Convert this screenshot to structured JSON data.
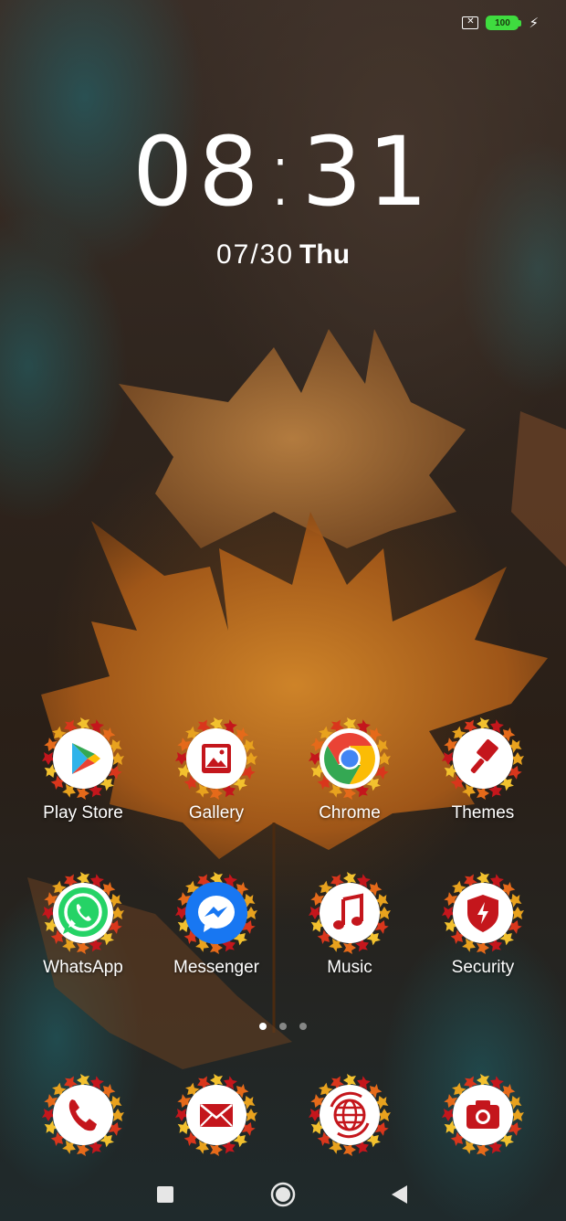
{
  "status_bar": {
    "sim_icon": "sim-missing-icon",
    "battery_level": "100",
    "charging_icon": "bolt-icon"
  },
  "clock": {
    "time_hours": "08",
    "time_minutes": "31",
    "date_num": "07/30",
    "date_day": "Thu"
  },
  "apps": [
    {
      "label": "Play Store",
      "icon": "play-store-icon"
    },
    {
      "label": "Gallery",
      "icon": "gallery-icon"
    },
    {
      "label": "Chrome",
      "icon": "chrome-icon"
    },
    {
      "label": "Themes",
      "icon": "themes-brush-icon"
    },
    {
      "label": "WhatsApp",
      "icon": "whatsapp-icon"
    },
    {
      "label": "Messenger",
      "icon": "messenger-icon"
    },
    {
      "label": "Music",
      "icon": "music-note-icon"
    },
    {
      "label": "Security",
      "icon": "security-shield-icon"
    }
  ],
  "dock": [
    {
      "icon": "phone-icon"
    },
    {
      "icon": "messages-envelope-icon"
    },
    {
      "icon": "browser-globe-icon"
    },
    {
      "icon": "camera-icon"
    }
  ],
  "page_indicator": {
    "pages": 3,
    "current": 1
  },
  "nav": [
    "recents-square-icon",
    "home-circle-icon",
    "back-triangle-icon"
  ],
  "colors": {
    "theme_red": "#c4161c",
    "leaf_orange": "#e08a1e",
    "battery_green": "#3fdc3f"
  }
}
